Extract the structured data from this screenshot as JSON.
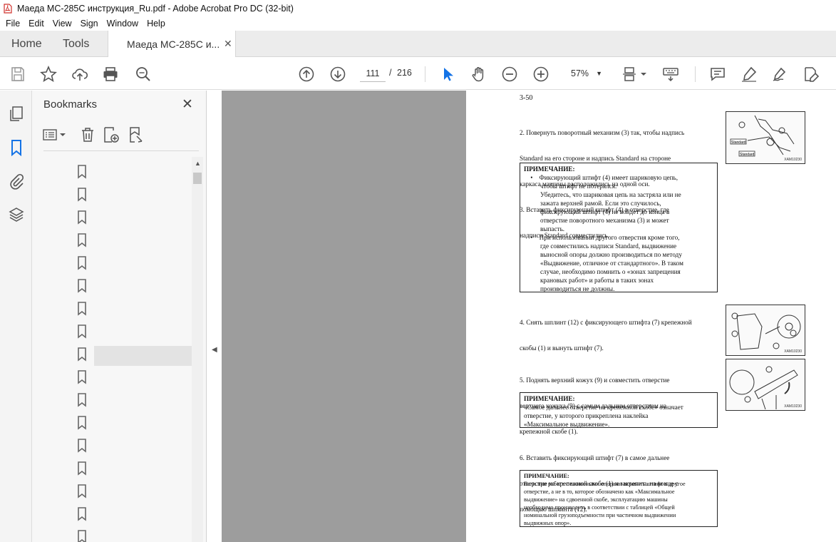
{
  "window": {
    "title": "Маеда МС-285С инструкция_Ru.pdf - Adobe Acrobat Pro DC (32-bit)"
  },
  "menu": [
    "File",
    "Edit",
    "View",
    "Sign",
    "Window",
    "Help"
  ],
  "tabs": {
    "home": "Home",
    "tools": "Tools",
    "document": "Маеда МС-285С и..."
  },
  "navigation": {
    "current_page": "111",
    "separator": "/",
    "total_pages": "216",
    "zoom": "57%"
  },
  "bookmarks": {
    "title": "Bookmarks",
    "item_count": 17,
    "selected_index": 8
  },
  "page": {
    "number": "3-50",
    "step2": [
      "2. Повернуть поворотный механизм (3) так, чтобы надпись",
      "Standard на его стороне и надпись Standard на стороне",
      "каркаса машины расположились на одной оси.",
      "3. Вставить фиксирующий штифт (4) в отверстие, где",
      "надписи Standard совместились."
    ],
    "note1": {
      "title": "ПРИМЕЧАНИЕ:",
      "lines": [
        "    •    Фиксирующий штифт (4) имеет шариковую цепь,",
        "          чтобы штифт не потерялся.",
        "          Убедитесь, что шариковая цепь на застряла или не",
        "          зажата верхней рамой. Если это случилось,",
        "          фиксирующий штифт (4) не войдет до конца в",
        "          отверстие поворотного механизма (3) и может",
        "          выпасть.",
        "    •    При использовании другого отверстия кроме того,",
        "          где совместились надписи Standard, выдвижение",
        "          выносной опоры должно производиться по методу",
        "          «Выдвижение, отличное от стандартного». В таком",
        "          случае, необходимо помнить о «зонах запрещения",
        "          крановых работ» и работы в таких зонах",
        "          производиться не должны."
      ]
    },
    "step4": [
      "4. Снять шплинт (12) с фиксирующего штифта (7) крепежной",
      "скобы (1) и вынуть штифт (7)."
    ],
    "step5": [
      "5. Поднять верхний кожух (9) и совместить отверстие",
      "верхнего кожуха (9) с самым дальним отверстием на",
      "крепежной скобе (1)."
    ],
    "note2": {
      "title": "ПРИМЕЧАНИЕ:",
      "lines": [
        "«Самое дальнее отверстие на крепежной скобе» означает",
        "отверстие, у которого прикреплена наклейка",
        "«Максимальное выдвижение»."
      ]
    },
    "step6": [
      "6. Вставить фиксирующий штифт (7) в самое дальнее",
      "отверстие на крепежной скобе (1) и закрепить на конце с",
      "помощью шплинта (12)."
    ],
    "note3": {
      "title": "ПРИМЕЧАНИЕ:",
      "lines": [
        "Если при работе с выносными опорами вставить штифт в другое",
        "отверстие, а не в то, которое обозначено как «Максимальное",
        "выдвижение» на сдвоенной скобе, эксплуатацию машины",
        "необходимо производить в соответствии с таблицей «Общей",
        "номинальной грузоподъемности при частичном выдвижении",
        "выдвижных опор»."
      ]
    },
    "figure_codes": [
      "XAM10230",
      "XAM10230",
      "XAM10230"
    ],
    "figure_labels": {
      "standard": "Standard"
    }
  },
  "colors": {
    "accent": "#1473e6",
    "doc_bg": "#9d9d9d",
    "icon": "#555555"
  }
}
